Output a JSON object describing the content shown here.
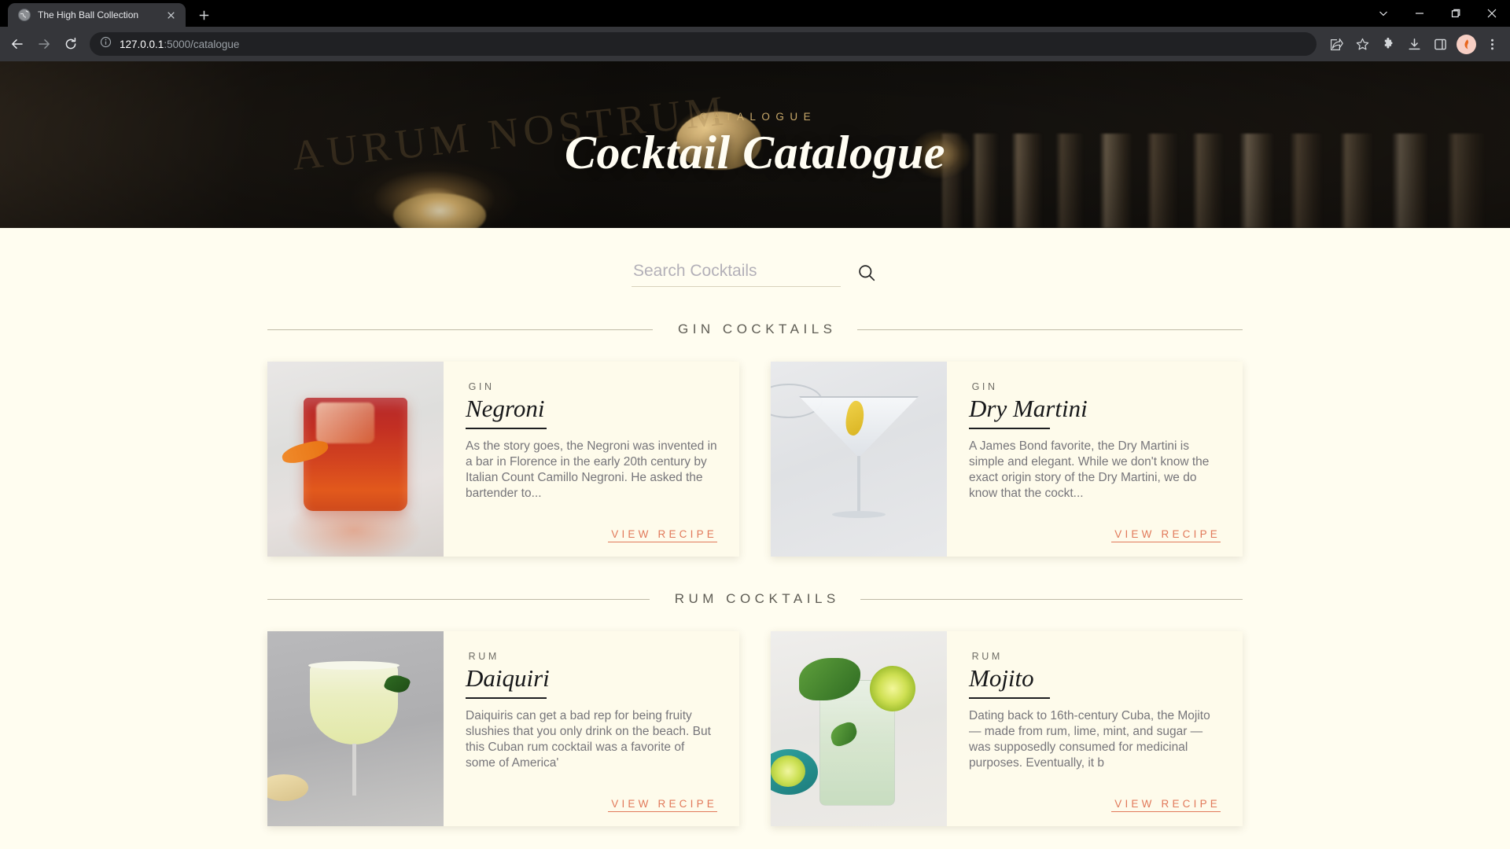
{
  "browser": {
    "tab": {
      "title": "The High Ball Collection",
      "favicon_icon": "globe-icon",
      "close_icon": "close-icon"
    },
    "new_tab_icon": "plus-icon",
    "window_controls": {
      "expand_icon": "chevron-down-icon",
      "minimize_icon": "minimize-icon",
      "maximize_icon": "maximize-icon",
      "close_icon": "close-icon"
    },
    "nav": {
      "back_icon": "back-arrow-icon",
      "forward_icon": "forward-arrow-icon",
      "reload_icon": "reload-icon"
    },
    "omnibox": {
      "info_icon": "site-info-icon",
      "host": "127.0.0.1",
      "path": ":5000/catalogue"
    },
    "toolbar_icons": [
      {
        "name": "share-icon"
      },
      {
        "name": "bookmark-star-icon"
      },
      {
        "name": "extensions-puzzle-icon"
      },
      {
        "name": "downloads-icon"
      },
      {
        "name": "side-panel-icon"
      },
      {
        "name": "profile-avatar-icon"
      },
      {
        "name": "three-dot-menu-icon"
      }
    ]
  },
  "hero": {
    "eyebrow": "CATALOGUE",
    "title": "Cocktail Catalogue",
    "background_wordmark": "AURUM NOSTRUM",
    "eyebrow_color": "#C9A96A",
    "title_color": "#FFFDF3"
  },
  "search": {
    "placeholder": "Search Cocktails",
    "value": "",
    "submit_icon": "search-icon"
  },
  "colors": {
    "page_background": "#FFFDF0",
    "card_background": "#FEFBEB",
    "accent_link": "#E1795A",
    "rule": "#BFBAA6",
    "body_text": "#76757A"
  },
  "sections": [
    {
      "heading": "GIN COCKTAILS",
      "cards": [
        {
          "category": "GIN",
          "title": "Negroni",
          "description": "As the story goes, the Negroni was invented in a bar in Florence in the early 20th century by Italian Count Camillo Negroni. He asked the bartender to...",
          "link_label": "VIEW RECIPE",
          "image_alt": "negroni-cocktail-photo"
        },
        {
          "category": "GIN",
          "title": "Dry Martini",
          "description": "A James Bond favorite, the Dry Martini is simple and elegant. While we don't know the exact origin story of the Dry Martini, we do know that the cockt...",
          "link_label": "VIEW RECIPE",
          "image_alt": "dry-martini-cocktail-photo"
        }
      ]
    },
    {
      "heading": "RUM COCKTAILS",
      "cards": [
        {
          "category": "RUM",
          "title": "Daiquiri",
          "description": "Daiquiris can get a bad rep for being fruity slushies that you only drink on the beach. But this Cuban rum cocktail was a favorite of some of America'",
          "link_label": "VIEW RECIPE",
          "image_alt": "daiquiri-cocktail-photo"
        },
        {
          "category": "RUM",
          "title": "Mojito",
          "description": "Dating back to 16th-century Cuba, the Mojito — made from rum, lime, mint, and sugar — was supposedly consumed for medicinal purposes. Eventually, it b",
          "link_label": "VIEW RECIPE",
          "image_alt": "mojito-cocktail-photo"
        }
      ]
    }
  ]
}
